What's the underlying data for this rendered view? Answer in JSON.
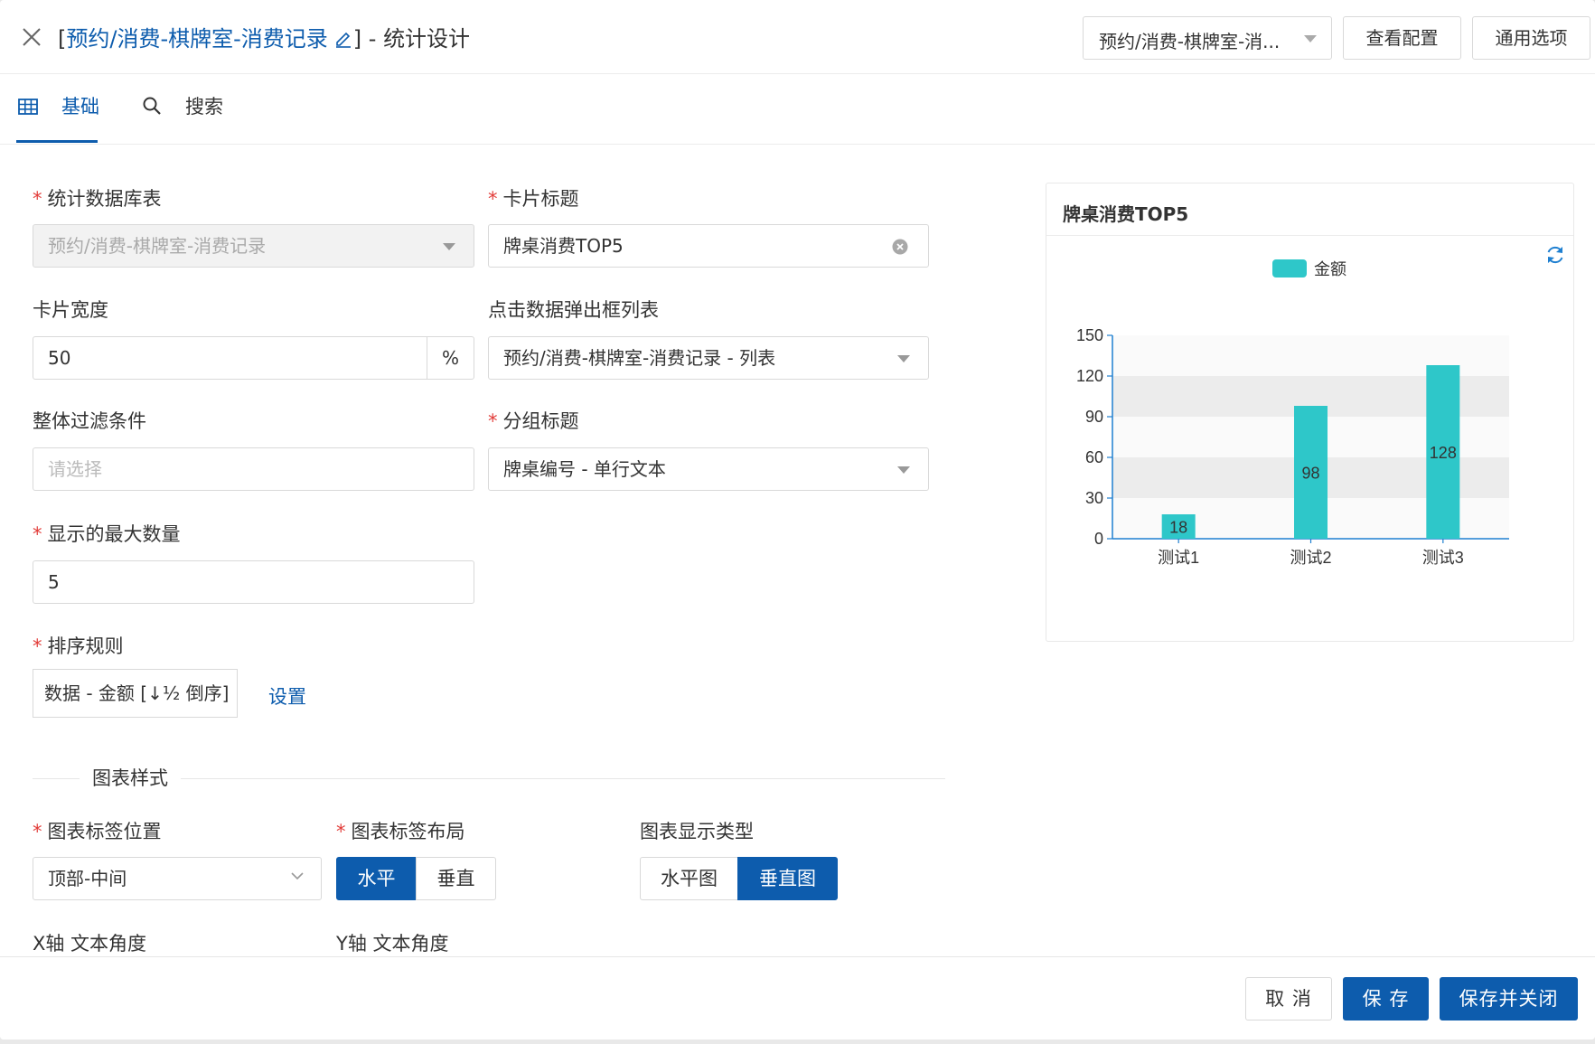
{
  "header": {
    "title_open": "[",
    "title_link": "预约/消费-棋牌室-消费记录",
    "title_close": "] - 统计设计",
    "select_value": "预约/消费-棋牌室-消...",
    "view_config_label": "查看配置",
    "general_options_label": "通用选项"
  },
  "tabs": [
    {
      "label": "基础",
      "icon": "table-icon",
      "active": true
    },
    {
      "label": "搜索",
      "icon": "search-icon",
      "active": false
    }
  ],
  "form": {
    "datasource": {
      "label": "统计数据库表",
      "required": true,
      "value": "预约/消费-棋牌室-消费记录"
    },
    "card_title": {
      "label": "卡片标题",
      "required": true,
      "value": "牌桌消费TOP5"
    },
    "card_width": {
      "label": "卡片宽度",
      "value": "50",
      "suffix": "%"
    },
    "popup_list": {
      "label": "点击数据弹出框列表",
      "value": "预约/消费-棋牌室-消费记录 - 列表"
    },
    "filter": {
      "label": "整体过滤条件",
      "placeholder": "请选择"
    },
    "group_title": {
      "label": "分组标题",
      "required": true,
      "value": "牌桌编号 - 单行文本"
    },
    "max_count": {
      "label": "显示的最大数量",
      "required": true,
      "value": "5"
    },
    "sort_rule": {
      "label": "排序规则",
      "required": true,
      "value": "数据 - 金额 [↓½ 倒序]",
      "settings_link": "设置"
    }
  },
  "chart_style": {
    "section_title": "图表样式",
    "label_position": {
      "label": "图表标签位置",
      "required": true,
      "value": "顶部-中间"
    },
    "label_layout": {
      "label": "图表标签布局",
      "required": true,
      "options": [
        "水平",
        "垂直"
      ],
      "selected": "水平"
    },
    "display_type": {
      "label": "图表显示类型",
      "options": [
        "水平图",
        "垂直图"
      ],
      "selected": "垂直图"
    },
    "x_axis_angle_label": "X轴 文本角度",
    "y_axis_angle_label": "Y轴 文本角度"
  },
  "chart_card": {
    "title": "牌桌消费TOP5"
  },
  "chart_data": {
    "type": "bar",
    "title": "牌桌消费TOP5",
    "categories": [
      "测试1",
      "测试2",
      "测试3"
    ],
    "series": [
      {
        "name": "金额",
        "values": [
          18,
          98,
          128
        ],
        "color": "#2ec7c9"
      }
    ],
    "ylim": [
      0,
      150
    ],
    "yticks": [
      0,
      30,
      60,
      90,
      120,
      150
    ],
    "data_labels": true,
    "legend": "top-center",
    "grid": "alternating-bands"
  },
  "footer": {
    "cancel_label": "取 消",
    "save_label": "保 存",
    "save_close_label": "保存并关闭"
  },
  "colors": {
    "primary": "#0d5cad",
    "required": "#e23c39",
    "bar": "#2ec7c9"
  }
}
